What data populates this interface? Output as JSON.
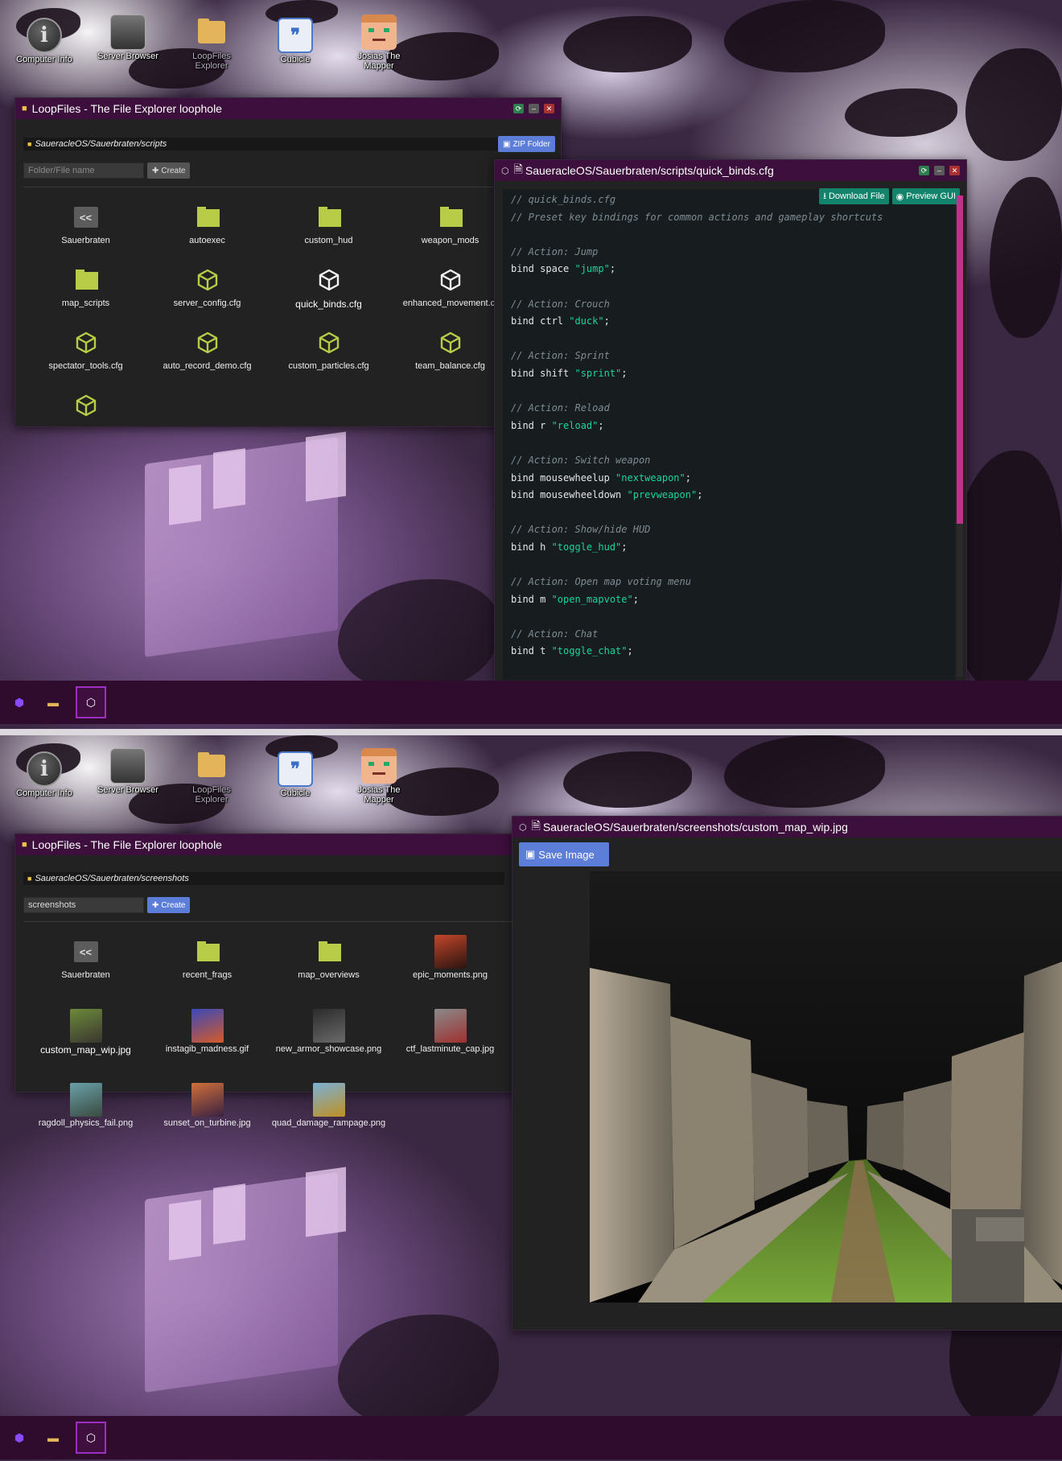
{
  "desktop_icons": [
    {
      "label": "Computer Info",
      "icon": "info-icon"
    },
    {
      "label": "Server Browser",
      "icon": "server-icon"
    },
    {
      "label": "LoopFiles Explorer",
      "icon": "folder-icon"
    },
    {
      "label": "Cubicle",
      "icon": "chat-bubble-icon"
    },
    {
      "label": "Josias The Mapper",
      "icon": "avatar-face-icon"
    }
  ],
  "top": {
    "explorer": {
      "title": "LoopFiles - The File Explorer loophole",
      "path": "SaueracleOS/Sauerbraten/scripts",
      "zip_label": "ZIP Folder",
      "input_placeholder": "Folder/File name",
      "create_label": "Create",
      "items": [
        {
          "name": "Sauerbraten",
          "type": "back",
          "glyph": "<<"
        },
        {
          "name": "autoexec",
          "type": "folder"
        },
        {
          "name": "custom_hud",
          "type": "folder"
        },
        {
          "name": "weapon_mods",
          "type": "folder"
        },
        {
          "name": "map_scripts",
          "type": "folder"
        },
        {
          "name": "server_config.cfg",
          "type": "cfg"
        },
        {
          "name": "quick_binds.cfg",
          "type": "cfg-selected"
        },
        {
          "name": "enhanced_movement.cf",
          "type": "cfg-white"
        },
        {
          "name": "spectator_tools.cfg",
          "type": "cfg"
        },
        {
          "name": "auto_record_demo.cfg",
          "type": "cfg"
        },
        {
          "name": "custom_particles.cfg",
          "type": "cfg"
        },
        {
          "name": "team_balance.cfg",
          "type": "cfg"
        },
        {
          "name": "",
          "type": "cfg"
        }
      ]
    },
    "editor": {
      "title": "SaueracleOS/Sauerbraten/scripts/quick_binds.cfg",
      "download_label": "Download File",
      "preview_label": "Preview GUI",
      "lines": [
        {
          "t": "c",
          "text": "// quick_binds.cfg"
        },
        {
          "t": "c",
          "text": "// Preset key bindings for common actions and gameplay shortcuts"
        },
        {
          "t": "blank"
        },
        {
          "t": "c",
          "text": "// Action: Jump"
        },
        {
          "t": "b",
          "pre": "bind space ",
          "str": "\"jump\""
        },
        {
          "t": "blank"
        },
        {
          "t": "c",
          "text": "// Action: Crouch"
        },
        {
          "t": "b",
          "pre": "bind ctrl ",
          "str": "\"duck\""
        },
        {
          "t": "blank"
        },
        {
          "t": "c",
          "text": "// Action: Sprint"
        },
        {
          "t": "b",
          "pre": "bind shift ",
          "str": "\"sprint\""
        },
        {
          "t": "blank"
        },
        {
          "t": "c",
          "text": "// Action: Reload"
        },
        {
          "t": "b",
          "pre": "bind r ",
          "str": "\"reload\""
        },
        {
          "t": "blank"
        },
        {
          "t": "c",
          "text": "// Action: Switch weapon"
        },
        {
          "t": "b",
          "pre": "bind mousewheelup ",
          "str": "\"nextweapon\""
        },
        {
          "t": "b",
          "pre": "bind mousewheeldown ",
          "str": "\"prevweapon\""
        },
        {
          "t": "blank"
        },
        {
          "t": "c",
          "text": "// Action: Show/hide HUD"
        },
        {
          "t": "b",
          "pre": "bind h ",
          "str": "\"toggle_hud\""
        },
        {
          "t": "blank"
        },
        {
          "t": "c",
          "text": "// Action: Open map voting menu"
        },
        {
          "t": "b",
          "pre": "bind m ",
          "str": "\"open_mapvote\""
        },
        {
          "t": "blank"
        },
        {
          "t": "c",
          "text": "// Action: Chat"
        },
        {
          "t": "b",
          "pre": "bind t ",
          "str": "\"toggle_chat\""
        }
      ]
    }
  },
  "bottom": {
    "explorer": {
      "title": "LoopFiles - The File Explorer loophole",
      "path": "SaueracleOS/Sauerbraten/screenshots",
      "input_value": "screenshots",
      "create_label": "Create",
      "items": [
        {
          "name": "Sauerbraten",
          "type": "back",
          "glyph": "<<"
        },
        {
          "name": "recent_frags",
          "type": "folder"
        },
        {
          "name": "map_overviews",
          "type": "folder"
        },
        {
          "name": "epic_moments.png",
          "type": "img",
          "c1": "#c4462a",
          "c2": "#2a1410"
        },
        {
          "name": "custom_map_wip.jpg",
          "type": "img-selected",
          "c1": "#6b8a3a",
          "c2": "#3b3630"
        },
        {
          "name": "instagib_madness.gif",
          "type": "img",
          "c1": "#3a4ab8",
          "c2": "#d45a2a"
        },
        {
          "name": "new_armor_showcase.png",
          "type": "img",
          "c1": "#2b2b2b",
          "c2": "#6a6a6a"
        },
        {
          "name": "ctf_lastminute_cap.jpg",
          "type": "img",
          "c1": "#8a8a8a",
          "c2": "#a03030"
        },
        {
          "name": "ragdoll_physics_fail.png",
          "type": "img",
          "c1": "#6aa0a8",
          "c2": "#3a4a40"
        },
        {
          "name": "sunset_on_turbine.jpg",
          "type": "img",
          "c1": "#d0703a",
          "c2": "#3a2040"
        },
        {
          "name": "quad_damage_rampage.png",
          "type": "img",
          "c1": "#7ab0d8",
          "c2": "#c09020"
        }
      ]
    },
    "viewer": {
      "title": "SaueracleOS/Sauerbraten/screenshots/custom_map_wip.jpg",
      "save_label": "Save Image"
    }
  },
  "colors": {
    "titlebar": "#3d0f3d",
    "accent_blue": "#5d7ed8",
    "accent_green": "#13836b",
    "folder_green": "#b8cc48",
    "scroll_pink": "#c0338c",
    "taskbar": "#2f0c2e"
  }
}
